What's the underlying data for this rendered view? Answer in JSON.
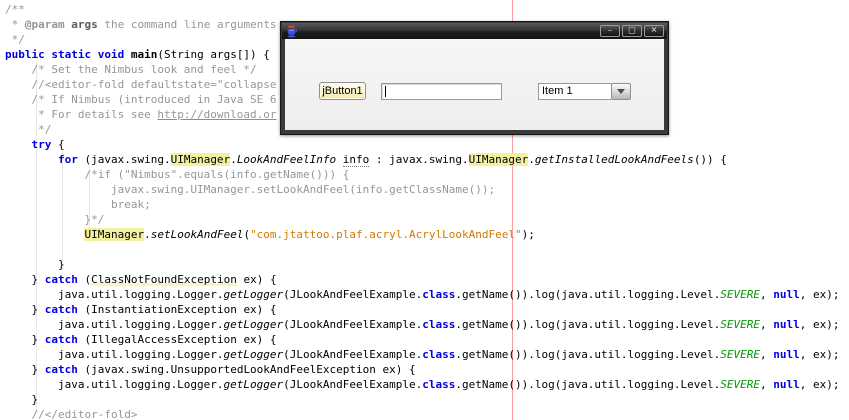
{
  "editor": {
    "colors": {
      "keyword": "#0000e6",
      "comment": "#969696",
      "string": "#ce7b00",
      "constant_field": "#009900",
      "occurrence_highlight": "#f3f0a0",
      "right_margin_line": "#ff9c9c"
    },
    "lines": [
      [
        [
          "c",
          "/**"
        ]
      ],
      [
        [
          "c",
          " * "
        ],
        [
          "cb",
          "@param"
        ],
        [
          "c",
          " "
        ],
        [
          "cn",
          "args"
        ],
        [
          "c",
          " the command line arguments"
        ]
      ],
      [
        [
          "c",
          " */"
        ]
      ],
      [
        [
          "k",
          "public static void "
        ],
        [
          "bd",
          "main"
        ],
        [
          "p",
          "(String args[]) {"
        ]
      ],
      [
        [
          "c",
          "    /* Set the Nimbus look and feel */"
        ]
      ],
      [
        [
          "c",
          "    //<editor-fold defaultstate=\"collapse"
        ]
      ],
      [
        [
          "c",
          "    /* If Nimbus (introduced in Java SE 6"
        ]
      ],
      [
        [
          "c",
          "     * For details see "
        ],
        [
          "lk",
          "http://download.or"
        ]
      ],
      [
        [
          "c",
          "     */"
        ]
      ],
      [
        [
          "p",
          "    "
        ],
        [
          "k",
          "try"
        ],
        [
          "p",
          " {"
        ]
      ],
      [
        [
          "p",
          "        "
        ],
        [
          "k",
          "for"
        ],
        [
          "p",
          " (javax.swing."
        ],
        [
          "hl",
          "UIManager"
        ],
        [
          "p",
          "."
        ],
        [
          "it",
          "LookAndFeelInfo"
        ],
        [
          "p",
          " "
        ],
        [
          "un",
          "info"
        ],
        [
          "p",
          " : javax.swing."
        ],
        [
          "hl",
          "UIManager"
        ],
        [
          "p",
          "."
        ],
        [
          "it",
          "getInstalledLookAndFeels"
        ],
        [
          "p",
          "()) {"
        ]
      ],
      [
        [
          "c",
          "            /*if (\"Nimbus\".equals(info.getName())) {"
        ]
      ],
      [
        [
          "c",
          "                javax.swing.UIManager.setLookAndFeel(info.getClassName());"
        ]
      ],
      [
        [
          "c",
          "                break;"
        ]
      ],
      [
        [
          "c",
          "            }*/"
        ]
      ],
      [
        [
          "p",
          "            "
        ],
        [
          "hl",
          "UIManager"
        ],
        [
          "p",
          "."
        ],
        [
          "it",
          "setLookAndFeel"
        ],
        [
          "p",
          "("
        ],
        [
          "s",
          "\"com.jtattoo.plaf.acryl.AcrylLookAndFeel\""
        ],
        [
          "p",
          ");"
        ]
      ],
      [],
      [
        [
          "p",
          "        }"
        ]
      ],
      [
        [
          "p",
          "    } "
        ],
        [
          "k",
          "catch"
        ],
        [
          "p",
          " ("
        ],
        [
          "sf",
          "ClassNotFoundException"
        ],
        [
          "p",
          " ex) {"
        ]
      ],
      [
        [
          "p",
          "        java.util.logging.Logger."
        ],
        [
          "it",
          "getLogger"
        ],
        [
          "p",
          "(JLookAndFeelExample."
        ],
        [
          "k",
          "class"
        ],
        [
          "p",
          ".getName()).log(java.util.logging.Level."
        ],
        [
          "gi",
          "SEVERE"
        ],
        [
          "p",
          ", "
        ],
        [
          "k",
          "null"
        ],
        [
          "p",
          ", ex);"
        ]
      ],
      [
        [
          "p",
          "    } "
        ],
        [
          "k",
          "catch"
        ],
        [
          "p",
          " (InstantiationException ex) {"
        ]
      ],
      [
        [
          "p",
          "        java.util.logging.Logger."
        ],
        [
          "it",
          "getLogger"
        ],
        [
          "p",
          "(JLookAndFeelExample."
        ],
        [
          "k",
          "class"
        ],
        [
          "p",
          ".getName()).log(java.util.logging.Level."
        ],
        [
          "gi",
          "SEVERE"
        ],
        [
          "p",
          ", "
        ],
        [
          "k",
          "null"
        ],
        [
          "p",
          ", ex);"
        ]
      ],
      [
        [
          "p",
          "    } "
        ],
        [
          "k",
          "catch"
        ],
        [
          "p",
          " (IllegalAccessException ex) {"
        ]
      ],
      [
        [
          "p",
          "        java.util.logging.Logger."
        ],
        [
          "it",
          "getLogger"
        ],
        [
          "p",
          "(JLookAndFeelExample."
        ],
        [
          "k",
          "class"
        ],
        [
          "p",
          ".getName()).log(java.util.logging.Level."
        ],
        [
          "gi",
          "SEVERE"
        ],
        [
          "p",
          ", "
        ],
        [
          "k",
          "null"
        ],
        [
          "p",
          ", ex);"
        ]
      ],
      [
        [
          "p",
          "    } "
        ],
        [
          "k",
          "catch"
        ],
        [
          "p",
          " (javax.swing.UnsupportedLookAndFeelException ex) {"
        ]
      ],
      [
        [
          "p",
          "        java.util.logging.Logger."
        ],
        [
          "it",
          "getLogger"
        ],
        [
          "p",
          "(JLookAndFeelExample."
        ],
        [
          "k",
          "class"
        ],
        [
          "p",
          ".getName()).log(java.util.logging.Level."
        ],
        [
          "gi",
          "SEVERE"
        ],
        [
          "p",
          ", "
        ],
        [
          "k",
          "null"
        ],
        [
          "p",
          ", ex);"
        ]
      ],
      [
        [
          "p",
          "    }"
        ]
      ],
      [
        [
          "c",
          "    //</editor-fold>"
        ]
      ]
    ]
  },
  "window": {
    "title": "",
    "controls": {
      "minimize": "–",
      "maximize": "□",
      "close": "✕"
    },
    "button_label": "jButton1",
    "textfield_value": "",
    "combo_selected": "Item 1"
  }
}
